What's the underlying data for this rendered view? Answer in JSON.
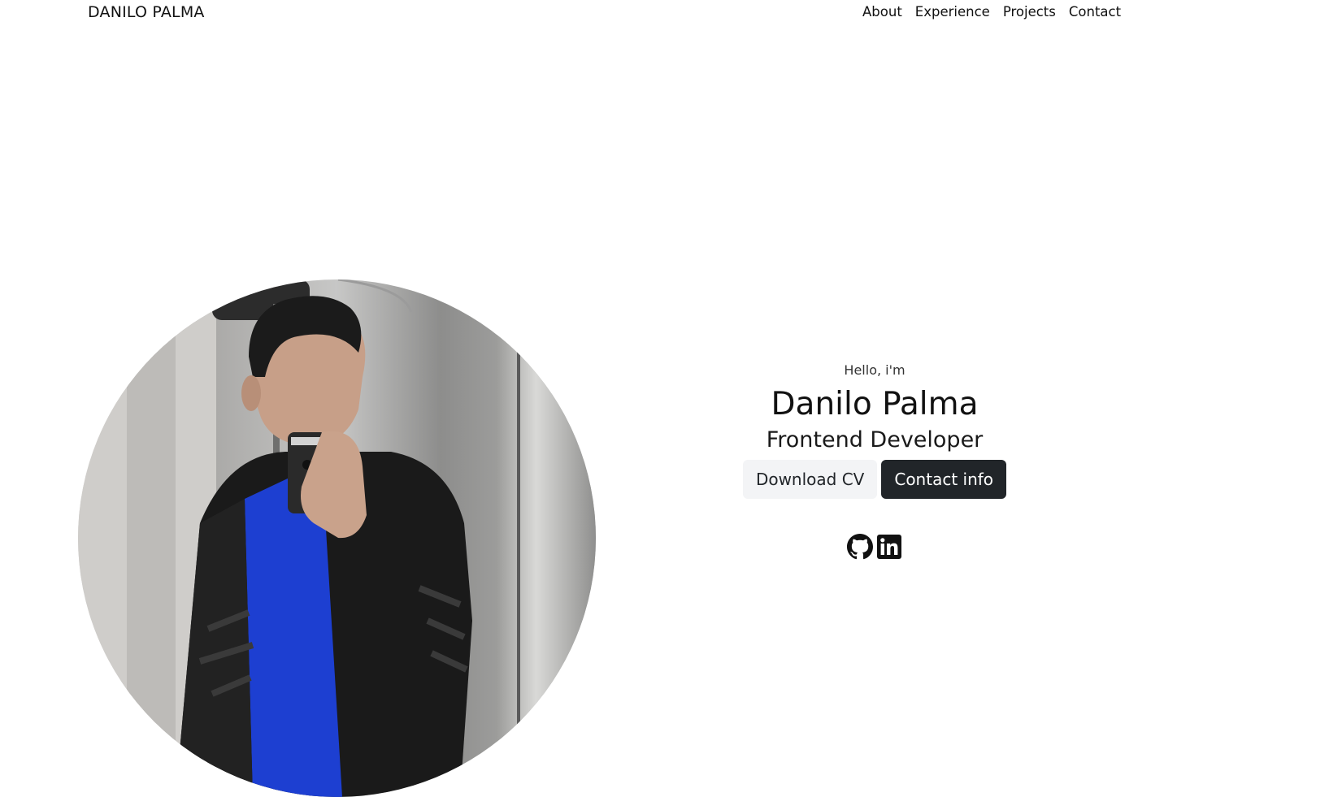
{
  "header": {
    "logo": "DANILO PALMA",
    "nav": [
      {
        "label": "About"
      },
      {
        "label": "Experience"
      },
      {
        "label": "Projects"
      },
      {
        "label": "Contact"
      }
    ]
  },
  "hero": {
    "greeting": "Hello, i'm",
    "name": "Danilo Palma",
    "title": "Frontend Developer",
    "buttons": {
      "download": "Download CV",
      "contact": "Contact info"
    },
    "socials": [
      {
        "icon": "github-icon"
      },
      {
        "icon": "linkedin-icon"
      }
    ]
  },
  "colors": {
    "text": "#111111",
    "button_dark": "#212529",
    "button_light": "#f3f4f6",
    "background": "#ffffff"
  }
}
